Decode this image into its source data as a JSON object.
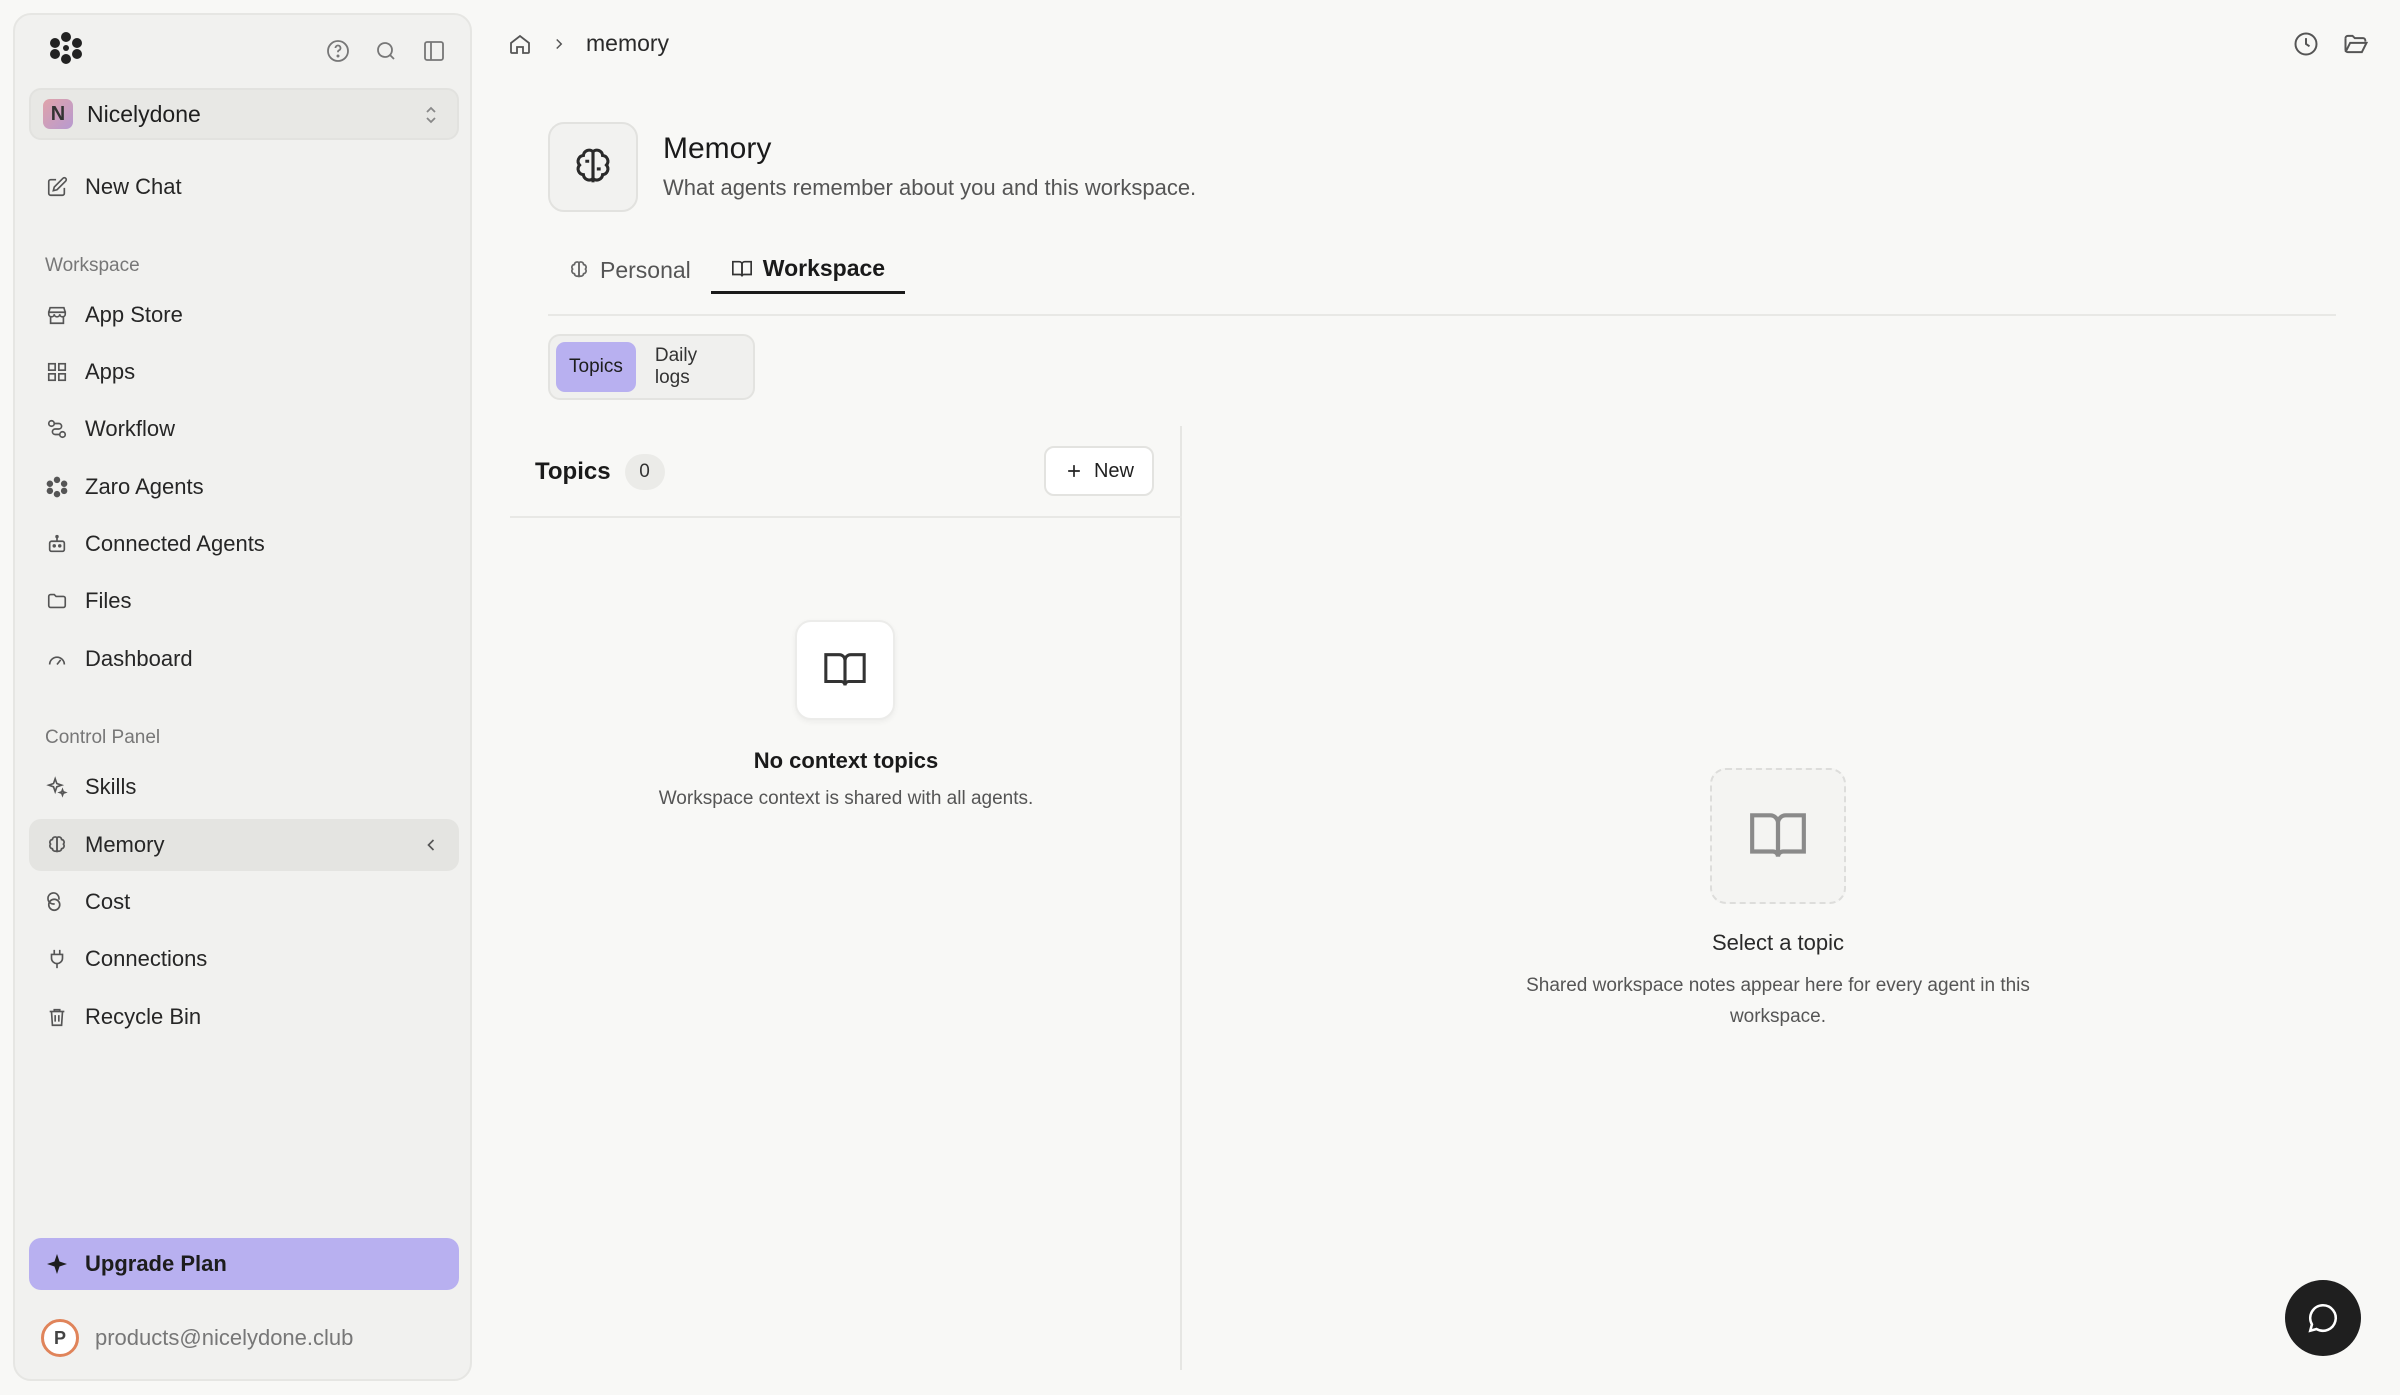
{
  "sidebar": {
    "workspace_initial": "N",
    "workspace_name": "Nicelydone",
    "new_chat": "New Chat",
    "workspace_label": "Workspace",
    "workspace_items": [
      "App Store",
      "Apps",
      "Workflow",
      "Zaro Agents",
      "Connected Agents",
      "Files",
      "Dashboard"
    ],
    "control_label": "Control Panel",
    "control_items": [
      "Skills",
      "Memory",
      "Cost",
      "Connections",
      "Recycle Bin"
    ],
    "active_item": "Memory",
    "upgrade": "Upgrade Plan",
    "user_initial": "P",
    "user_email": "products@nicelydone.club"
  },
  "breadcrumb": {
    "current": "memory"
  },
  "page": {
    "title": "Memory",
    "subtitle": "What agents remember about you and this workspace."
  },
  "tabs": [
    {
      "label": "Personal",
      "icon": "brain-icon",
      "active": false
    },
    {
      "label": "Workspace",
      "icon": "book-icon",
      "active": true
    }
  ],
  "segments": [
    {
      "label": "Topics",
      "active": true
    },
    {
      "label": "Daily logs",
      "active": false
    }
  ],
  "topics_pane": {
    "title": "Topics",
    "count": "0",
    "new_button": "New",
    "empty_title": "No context topics",
    "empty_sub": "Workspace context is shared with all agents."
  },
  "detail_pane": {
    "title": "Select a topic",
    "sub": "Shared workspace notes appear here for every agent in this workspace."
  },
  "colors": {
    "accent": "#b8b0f0",
    "sidebar_bg": "#f1f1ef",
    "page_bg": "#f8f8f6",
    "fab": "#1f1f1f"
  }
}
